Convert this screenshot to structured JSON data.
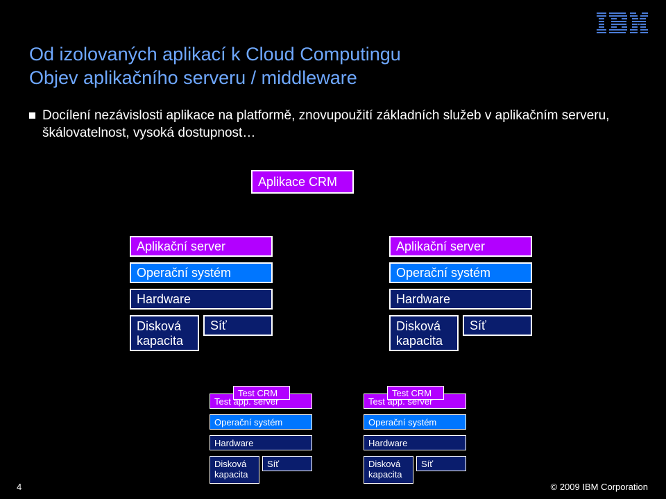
{
  "title": {
    "line1": "Od izolovaných aplikací k Cloud Computingu",
    "line2": "Objev aplikačního serveru / middleware"
  },
  "bullet": "Docílení nezávislosti aplikace na platformě, znovupoužití základních služeb v aplikačním serveru, škálovatelnost, vysoká dostupnost…",
  "app_crm": "Aplikace CRM",
  "main_stacks": {
    "app_server": "Aplikační server",
    "os": "Operační systém",
    "hw": "Hardware",
    "disk": "Disková\nkapacita",
    "net": "Síť"
  },
  "test_stacks": {
    "test_crm": "Test CRM",
    "test_app_server": "Test app. server",
    "os": "Operační systém",
    "hw": "Hardware",
    "disk": "Disková\nkapacita",
    "net": "Síť"
  },
  "footer": {
    "page": "4",
    "copyright": "© 2009 IBM Corporation"
  },
  "colors": {
    "title": "#6fa8ff",
    "purple": "#b200ff",
    "blue": "#0076ff",
    "navy": "#0a1d6d",
    "bg": "#000000"
  }
}
